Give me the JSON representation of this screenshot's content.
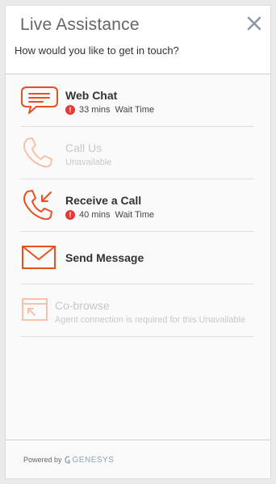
{
  "header": {
    "title": "Live Assistance",
    "subtitle": "How would you like to get in touch?"
  },
  "options": [
    {
      "label": "Web Chat",
      "wait_value": "33 mins",
      "wait_label": "Wait Time",
      "icon": "chat-bubble-icon",
      "enabled": true
    },
    {
      "label": "Call Us",
      "status": "Unavailable",
      "icon": "phone-icon",
      "enabled": false
    },
    {
      "label": "Receive a Call",
      "wait_value": "40 mins",
      "wait_label": "Wait Time",
      "icon": "phone-callback-icon",
      "enabled": true
    },
    {
      "label": "Send Message",
      "icon": "envelope-icon",
      "enabled": true
    },
    {
      "label": "Co-browse",
      "status": "Agent connection is required for this.Unavailable",
      "icon": "co-browse-icon",
      "enabled": false
    }
  ],
  "alert_glyph": "!",
  "footer": {
    "powered_by": "Powered by",
    "brand": "GENESYS"
  },
  "colors": {
    "accent": "#e8501e",
    "disabled_accent": "#f6c2ab",
    "alert": "#e53935"
  }
}
